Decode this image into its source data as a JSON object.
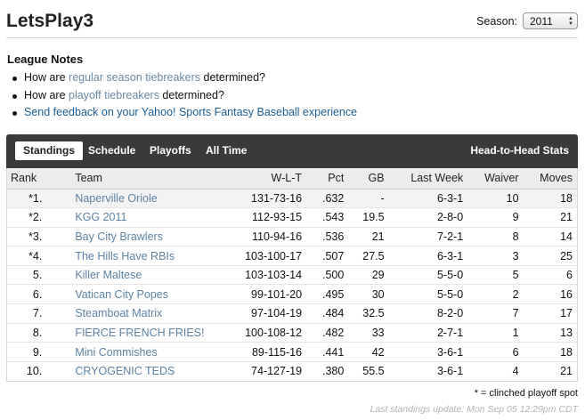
{
  "header": {
    "title": "LetsPlay3",
    "season_label": "Season:",
    "season_value": "2011"
  },
  "notes": {
    "heading": "League Notes",
    "items": [
      {
        "prefix": "How are ",
        "link": "regular season tiebreakers",
        "suffix": " determined?"
      },
      {
        "prefix": "How are ",
        "link": "playoff tiebreakers",
        "suffix": " determined?"
      },
      {
        "prefix": "",
        "link": "Send feedback on your Yahoo! Sports Fantasy Baseball experience",
        "suffix": ""
      }
    ]
  },
  "tabs": {
    "standings": "Standings",
    "schedule": "Schedule",
    "playoffs": "Playoffs",
    "all_time": "All Time",
    "h2h": "Head-to-Head Stats"
  },
  "table": {
    "headers": {
      "rank": "Rank",
      "team": "Team",
      "wlt": "W-L-T",
      "pct": "Pct",
      "gb": "GB",
      "last_week": "Last Week",
      "waiver": "Waiver",
      "moves": "Moves"
    },
    "rows": [
      {
        "rank": "*1.",
        "team": "Naperville Oriole",
        "wlt": "131-73-16",
        "pct": ".632",
        "gb": "-",
        "last_week": "6-3-1",
        "waiver": "10",
        "moves": "18"
      },
      {
        "rank": "*2.",
        "team": "KGG 2011",
        "wlt": "112-93-15",
        "pct": ".543",
        "gb": "19.5",
        "last_week": "2-8-0",
        "waiver": "9",
        "moves": "21"
      },
      {
        "rank": "*3.",
        "team": "Bay City Brawlers",
        "wlt": "110-94-16",
        "pct": ".536",
        "gb": "21",
        "last_week": "7-2-1",
        "waiver": "8",
        "moves": "14"
      },
      {
        "rank": "*4.",
        "team": "The Hills Have RBIs",
        "wlt": "103-100-17",
        "pct": ".507",
        "gb": "27.5",
        "last_week": "6-3-1",
        "waiver": "3",
        "moves": "25"
      },
      {
        "rank": "5.",
        "team": "Killer Maltese",
        "wlt": "103-103-14",
        "pct": ".500",
        "gb": "29",
        "last_week": "5-5-0",
        "waiver": "5",
        "moves": "6"
      },
      {
        "rank": "6.",
        "team": "Vatican City Popes",
        "wlt": "99-101-20",
        "pct": ".495",
        "gb": "30",
        "last_week": "5-5-0",
        "waiver": "2",
        "moves": "16"
      },
      {
        "rank": "7.",
        "team": "Steamboat Matrix",
        "wlt": "97-104-19",
        "pct": ".484",
        "gb": "32.5",
        "last_week": "8-2-0",
        "waiver": "7",
        "moves": "17"
      },
      {
        "rank": "8.",
        "team": "FIERCE FRENCH FRIES!",
        "wlt": "100-108-12",
        "pct": ".482",
        "gb": "33",
        "last_week": "2-7-1",
        "waiver": "1",
        "moves": "13"
      },
      {
        "rank": "9.",
        "team": "Mini Commishes",
        "wlt": "89-115-16",
        "pct": ".441",
        "gb": "42",
        "last_week": "3-6-1",
        "waiver": "6",
        "moves": "18"
      },
      {
        "rank": "10.",
        "team": "CRYOGENIC TEDS",
        "wlt": "74-127-19",
        "pct": ".380",
        "gb": "55.5",
        "last_week": "3-6-1",
        "waiver": "4",
        "moves": "21"
      }
    ]
  },
  "footer": {
    "clinched_note": "* = clinched playoff spot",
    "last_update": "Last standings update: Mon Sep 05 12:29pm CDT"
  },
  "colors": {
    "tabbar": "#3a3a3a",
    "link": "#5c82a6",
    "link_blue": "#1b5e95",
    "row_highlight": "#f3f3f3"
  }
}
